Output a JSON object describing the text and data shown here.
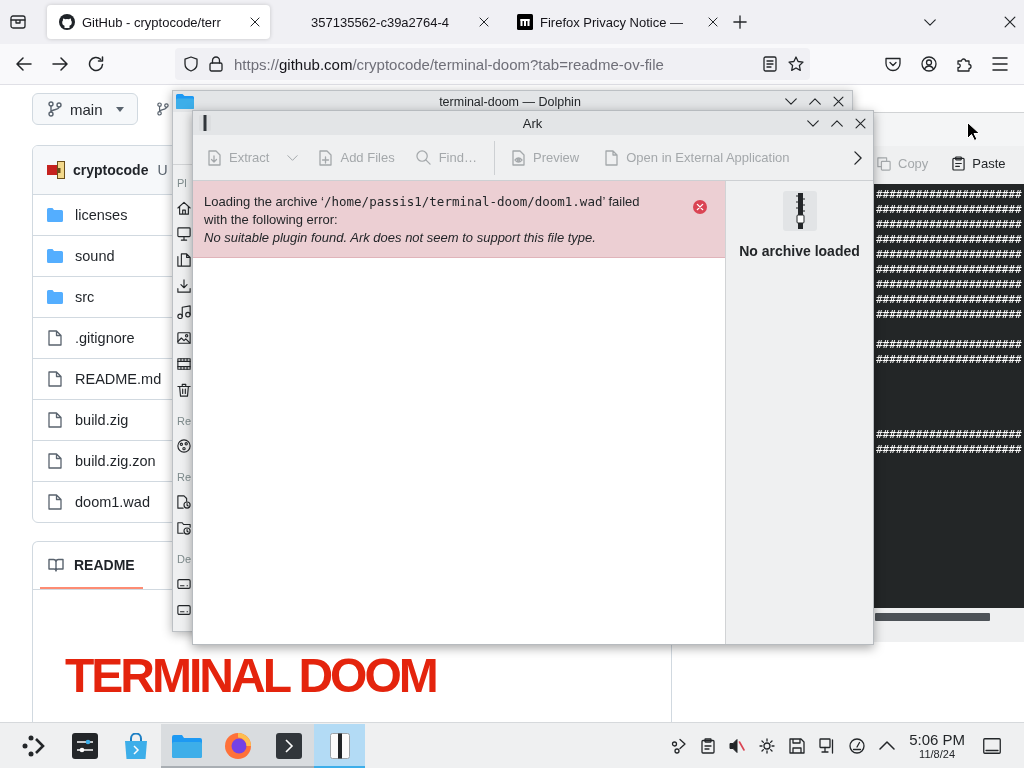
{
  "browser": {
    "tabs": [
      {
        "title": "GitHub - cryptocode/terr",
        "kind": "github",
        "selected": true
      },
      {
        "title": "357135562-c39a2764-4",
        "kind": "plain",
        "selected": false
      },
      {
        "title": "Firefox Privacy Notice —",
        "kind": "mozilla",
        "selected": false
      }
    ],
    "url": {
      "scheme": "https://",
      "host": "github.com",
      "path": "/cryptocode/terminal-doom?tab=readme-ov-file"
    }
  },
  "github": {
    "branch": "main",
    "files": {
      "author": "cryptocode",
      "commit_message": "U",
      "rows": [
        {
          "name": "licenses",
          "kind": "folder"
        },
        {
          "name": "sound",
          "kind": "folder"
        },
        {
          "name": "src",
          "kind": "folder"
        },
        {
          "name": ".gitignore",
          "kind": "file"
        },
        {
          "name": "README.md",
          "kind": "file"
        },
        {
          "name": "build.zig",
          "kind": "file"
        },
        {
          "name": "build.zig.zon",
          "kind": "file"
        },
        {
          "name": "doom1.wad",
          "kind": "file"
        }
      ]
    },
    "readme": {
      "tab": "README",
      "selected": true,
      "logo": "TERMINAL DOOM"
    }
  },
  "dolphin": {
    "title": "terminal-doom — Dolphin",
    "sidebar": [
      {
        "heading": "Pl",
        "items": [
          {
            "kind": "home"
          },
          {
            "kind": "desktop"
          },
          {
            "kind": "documents"
          },
          {
            "kind": "downloads"
          },
          {
            "kind": "music"
          },
          {
            "kind": "pictures"
          },
          {
            "kind": "videos"
          },
          {
            "kind": "trash"
          }
        ]
      },
      {
        "heading": "Re",
        "items": [
          {
            "kind": "network"
          }
        ]
      },
      {
        "heading": "Re",
        "items": [
          {
            "kind": "recent-files"
          },
          {
            "kind": "recent-locations"
          }
        ]
      },
      {
        "heading": "De",
        "items": [
          {
            "kind": "drive"
          },
          {
            "kind": "drive"
          }
        ]
      }
    ]
  },
  "ark": {
    "title": "Ark",
    "toolbar": [
      {
        "kind": "extract",
        "label": "Extract",
        "disabled": true,
        "dropdown": true
      },
      {
        "kind": "add",
        "label": "Add Files",
        "disabled": true,
        "dropdown": false
      },
      {
        "kind": "find",
        "label": "Find…",
        "disabled": true,
        "dropdown": false
      },
      {
        "kind": "separator"
      },
      {
        "kind": "preview",
        "label": "Preview",
        "disabled": true,
        "dropdown": false
      },
      {
        "kind": "open",
        "label": "Open in External Application",
        "disabled": true,
        "dropdown": false
      }
    ],
    "error": {
      "prefix": "Loading the archive ‘",
      "path": "/home/passis1/terminal-doom/doom1.wad",
      "suffix": "’ failed with the following error:",
      "detail": "No suitable plugin found. Ark does not seem to support this file type."
    },
    "info_panel": {
      "label": "No archive loaded"
    }
  },
  "konsole": {
    "toolbar": [
      {
        "kind": "copy",
        "label": "Copy",
        "disabled": true
      },
      {
        "kind": "paste",
        "label": "Paste",
        "disabled": false
      }
    ],
    "output": "######################\n######################\n######################\n######################\n######################\n######################\n######################\n######################\n######################\n\n######################\n######################\n\n\n\n\n######################\n######################"
  },
  "taskbar": {
    "tasks": [
      {
        "kind": "launcher",
        "running": false,
        "active": false
      },
      {
        "kind": "settings",
        "running": false,
        "active": false
      },
      {
        "kind": "store",
        "running": false,
        "active": false
      },
      {
        "kind": "files",
        "running": true,
        "active": false
      },
      {
        "kind": "browser",
        "running": true,
        "active": false
      },
      {
        "kind": "terminal",
        "running": true,
        "active": false
      },
      {
        "kind": "archiver",
        "running": true,
        "active": true
      }
    ],
    "tray": [
      {
        "kind": "connect"
      },
      {
        "kind": "clipboard"
      },
      {
        "kind": "volume",
        "muted": true
      },
      {
        "kind": "brightness"
      },
      {
        "kind": "disk"
      },
      {
        "kind": "network"
      },
      {
        "kind": "gauge"
      },
      {
        "kind": "expand"
      }
    ],
    "clock": {
      "time": "5:06 PM",
      "date": "11/8/24"
    }
  }
}
